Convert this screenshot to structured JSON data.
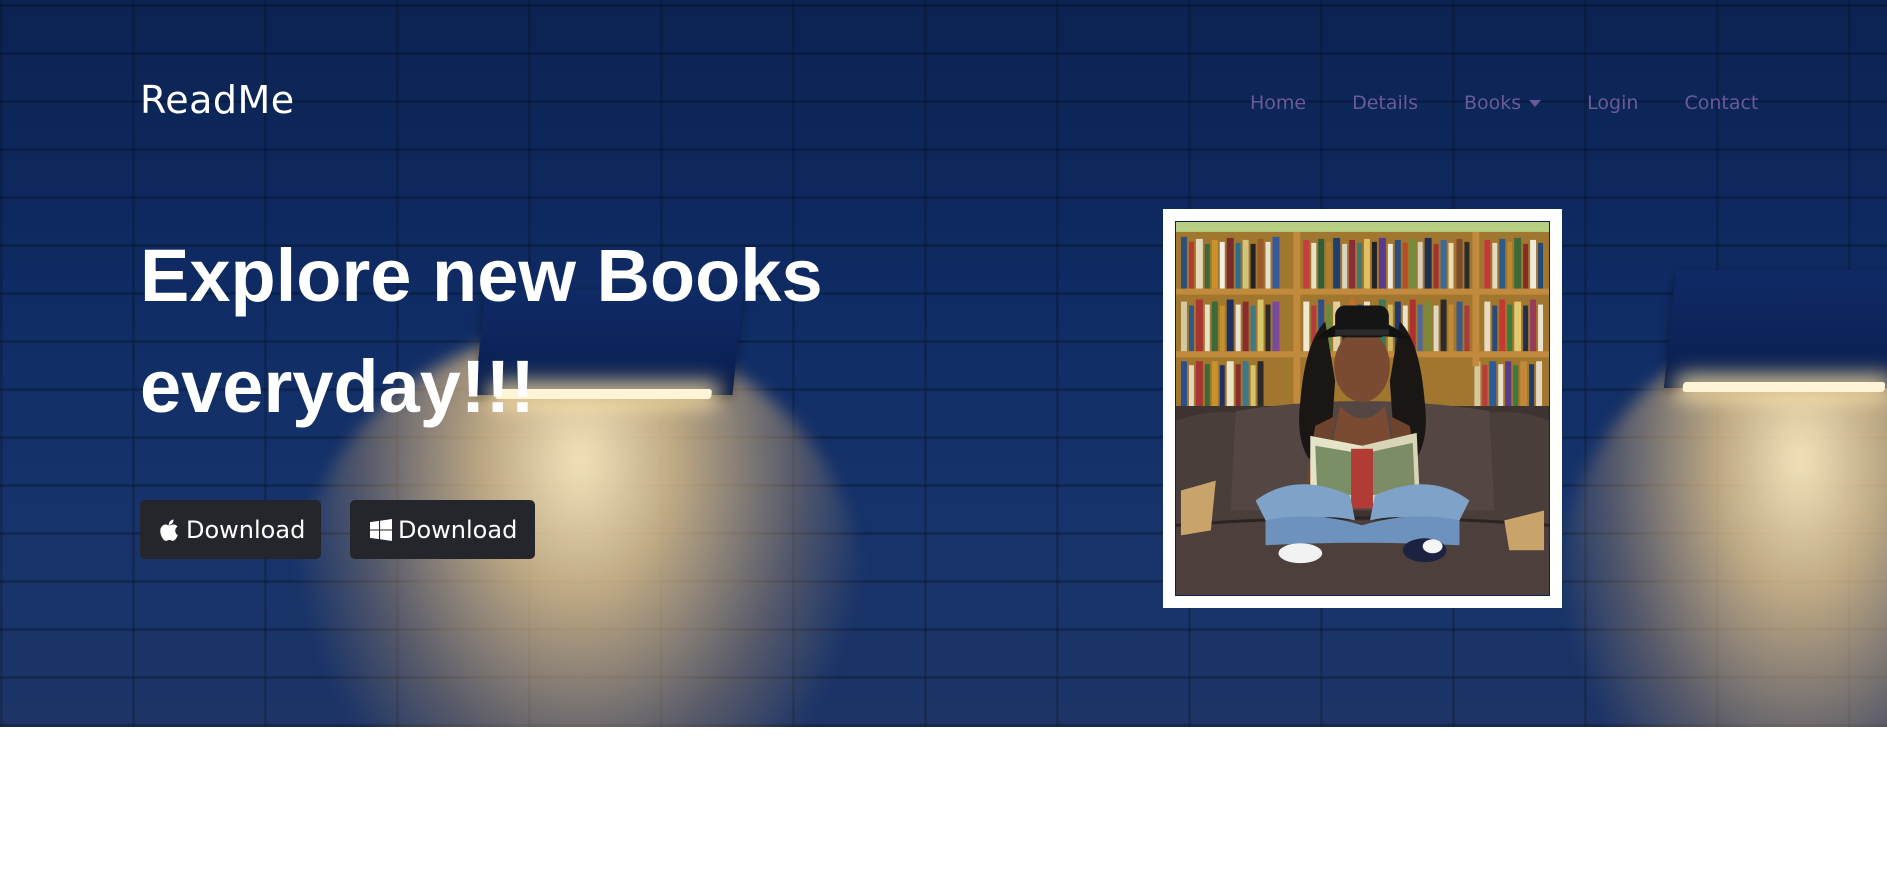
{
  "brand": "ReadMe",
  "nav": {
    "items": [
      "Home",
      "Details",
      "Books",
      "Login",
      "Contact"
    ]
  },
  "hero": {
    "headline": "Explore new Books everyday!!!"
  },
  "buttons": {
    "apple": "Download",
    "windows": "Download"
  },
  "icons": {
    "apple": "apple-icon",
    "windows": "windows-icon",
    "dropdown": "chevron-down-icon"
  },
  "colors": {
    "hero_bg": "#0f2b63",
    "nav_link": "#6a5a9a",
    "button_bg": "#24262b",
    "text": "#ffffff"
  }
}
